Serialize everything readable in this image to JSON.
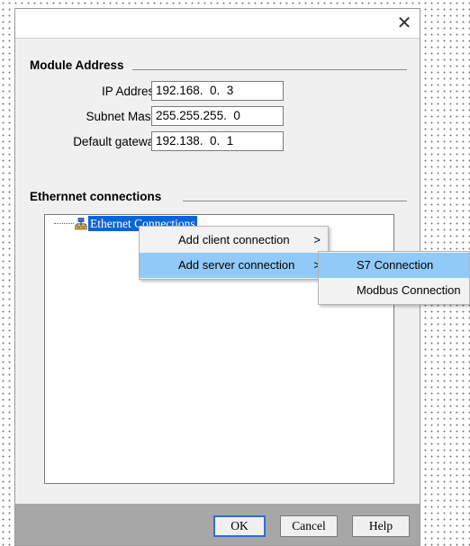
{
  "dialog": {
    "close_glyph": "✕",
    "module_address": {
      "title": "Module Address",
      "ip_label": "IP Address",
      "ip_value": "192.168.  0.  3",
      "subnet_label": "Subnet Mask:",
      "subnet_value": "255.255.255.  0",
      "gateway_label": "Default gateway",
      "gateway_value": "192.138.  0.  1"
    },
    "ethernet": {
      "title": "Ethernnet connections",
      "tree_root_label": "Ethernet Connections",
      "tree_icon": "network-icon"
    },
    "buttons": {
      "ok": "OK",
      "cancel": "Cancel",
      "help": "Help"
    }
  },
  "context_menu": {
    "items": [
      {
        "label": "Add client connection",
        "arrow": ">"
      },
      {
        "label": "Add server connection",
        "arrow": ">"
      }
    ]
  },
  "submenu": {
    "items": [
      {
        "label": "S7 Connection"
      },
      {
        "label": "Modbus Connection"
      }
    ]
  },
  "colors": {
    "selection": "#0a64d8",
    "menu_highlight": "#91c9f7",
    "footer": "#a7a7a7"
  }
}
